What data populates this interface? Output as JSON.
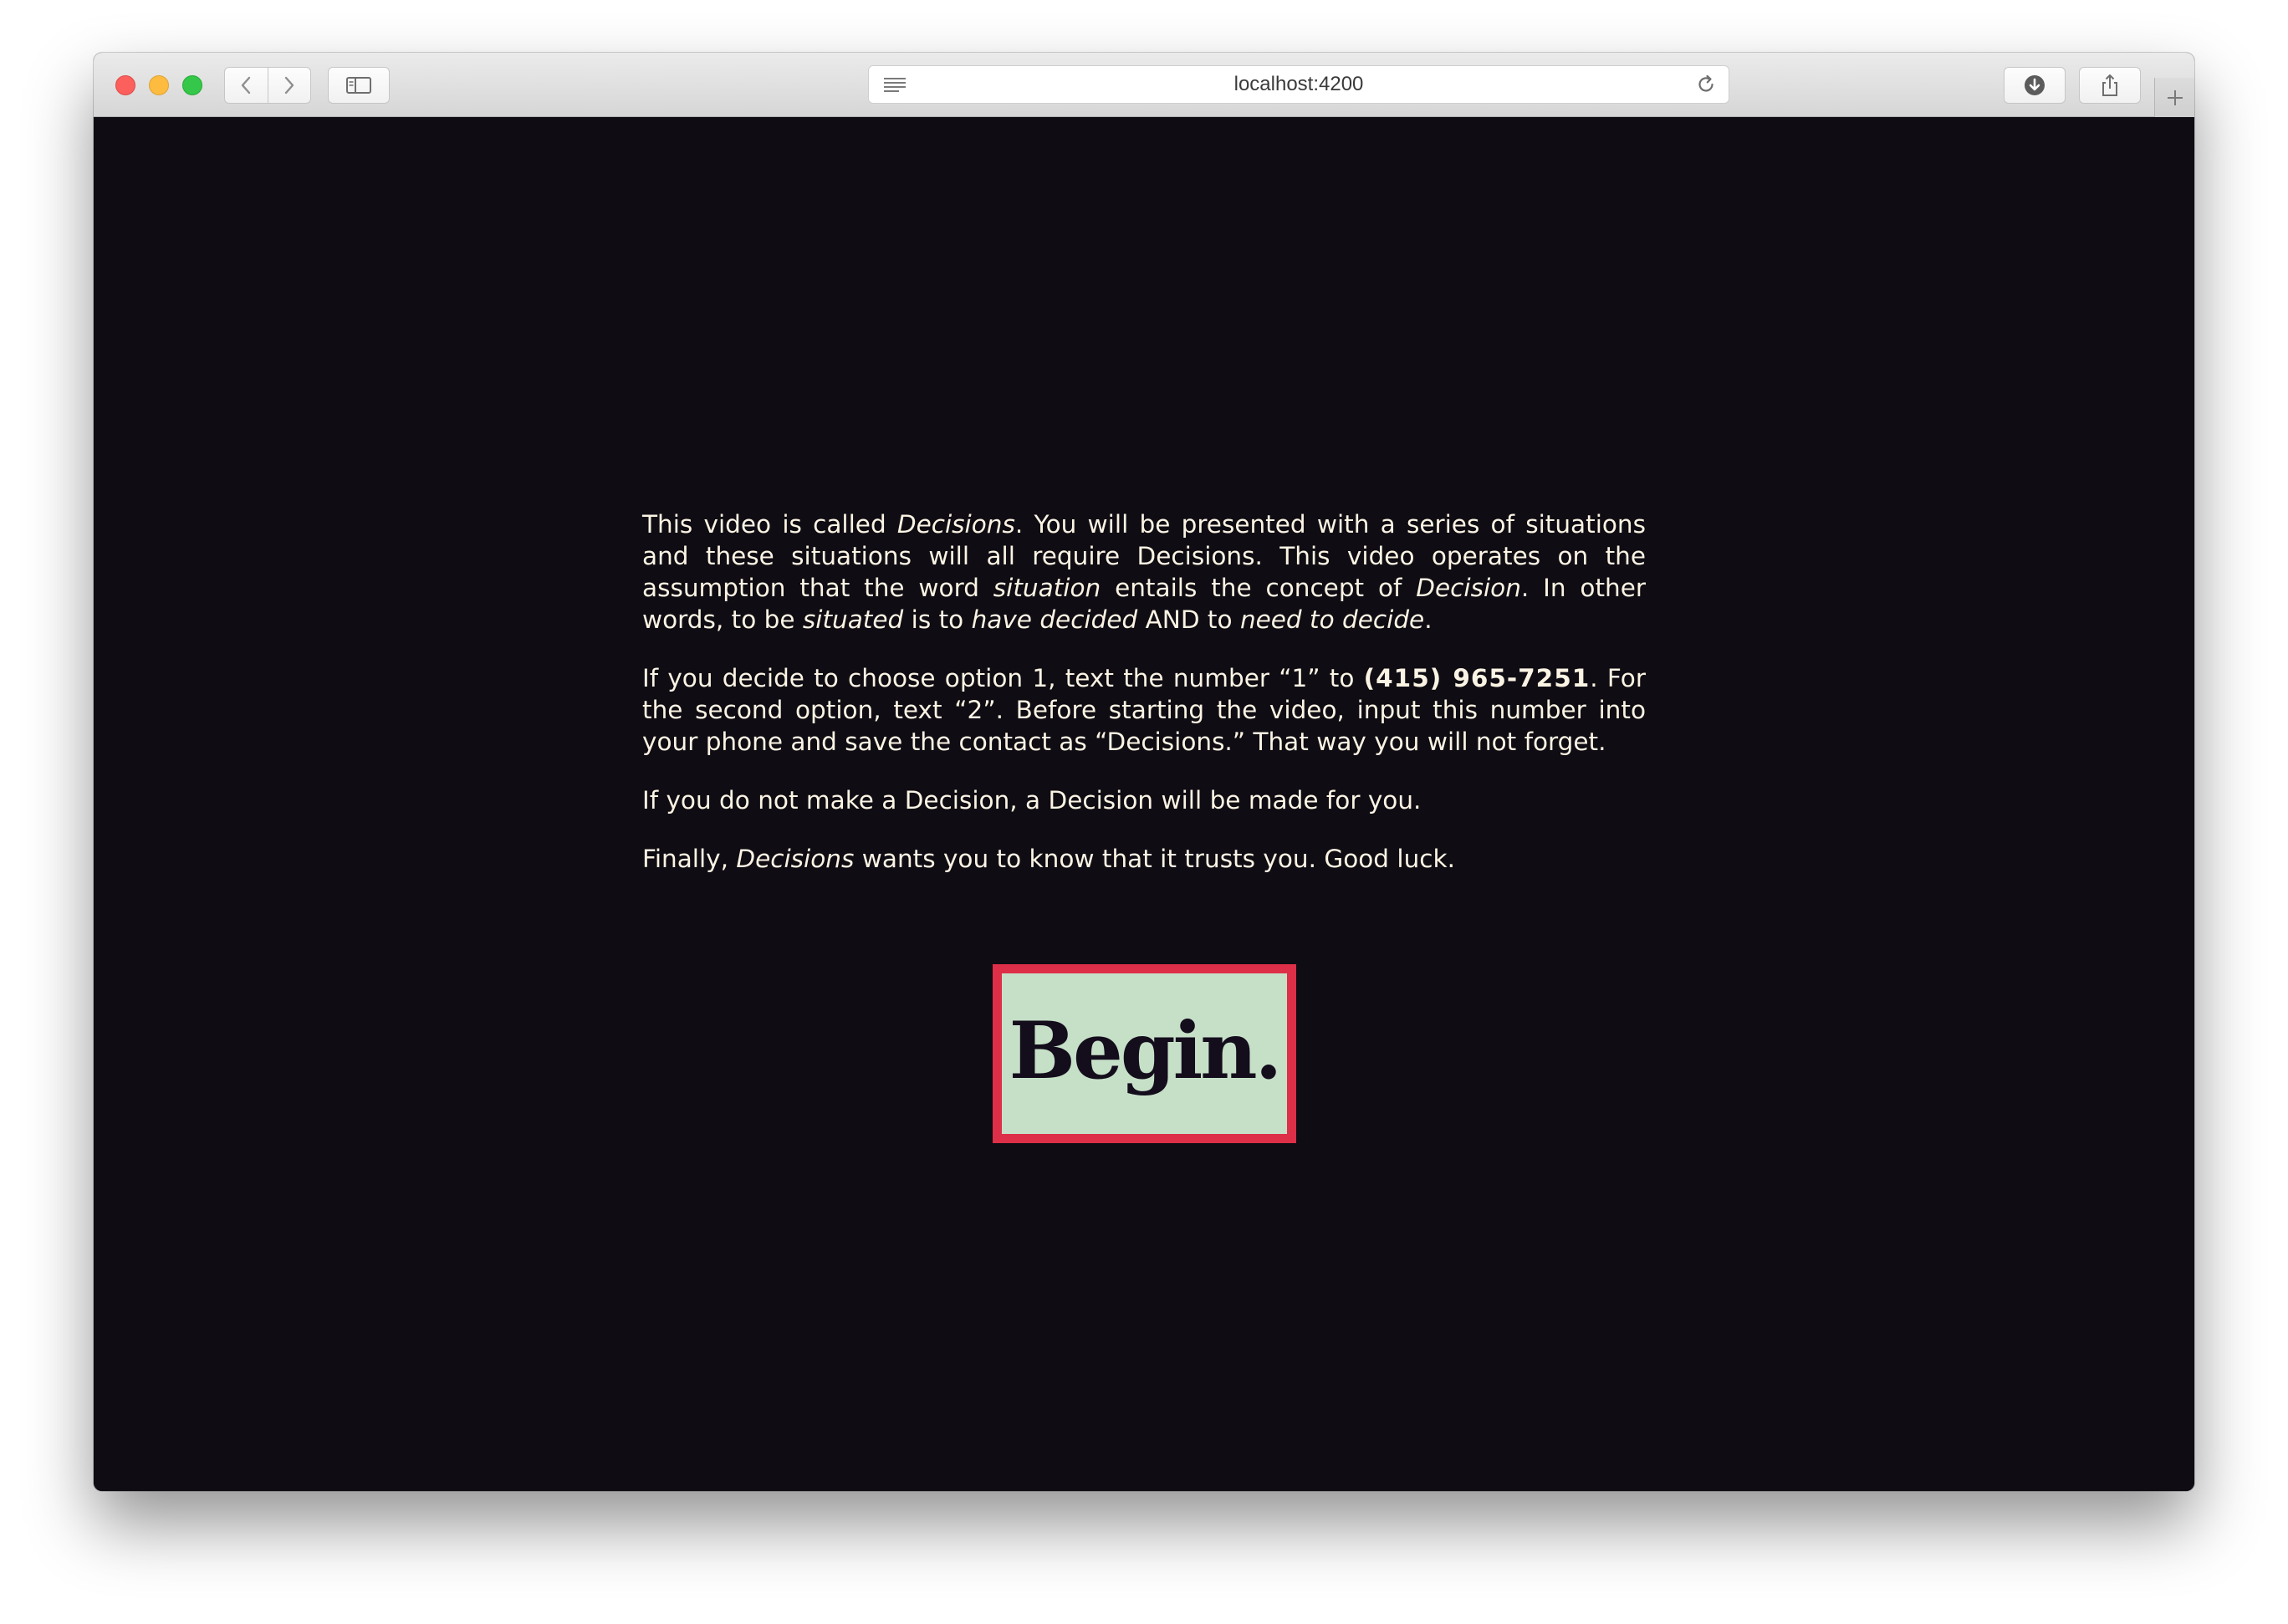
{
  "browser": {
    "url": "localhost:4200",
    "icons": {
      "close": "close-window-icon",
      "minimize": "minimize-window-icon",
      "maximize": "maximize-window-icon",
      "back": "chevron-left-icon",
      "forward": "chevron-right-icon",
      "sidebar": "sidebar-icon",
      "reader": "reader-lines-icon",
      "reload": "reload-icon",
      "download": "download-icon",
      "share": "share-icon",
      "new_tab": "plus-icon"
    }
  },
  "intro": {
    "p1": {
      "t1": "This video is called ",
      "e1": "Decisions",
      "t2": ". You will be presented with a series of situations and these situations will all require Decisions. This video operates on the assumption that the word ",
      "e2": "situation",
      "t3": " entails the concept of ",
      "e3": "Decision",
      "t4": ". In other words, to be ",
      "e4": "situated",
      "t5": " is to ",
      "e5": "have decided",
      "t6": " AND to ",
      "e6": "need to decide",
      "t7": "."
    },
    "p2": {
      "t1": "If you decide to choose option 1, text the number “1” to ",
      "phone": "(415) 965-7251",
      "t2": ". For the second option, text “2”. Before starting the video, input this number into your phone and save the contact as “Decisions.” That way you will not forget."
    },
    "p3": {
      "t1": "If you do not make a Decision, a Decision will be made for you."
    },
    "p4": {
      "t1": "Finally, ",
      "e1": "Decisions",
      "t2": " wants you to know that it trusts you. Good luck."
    }
  },
  "begin": {
    "label": "Begin."
  },
  "colors": {
    "background": "#0f0c13",
    "text": "#fbf4e4",
    "button_fill": "#c6e0c8",
    "button_border": "#dd2f47",
    "button_text": "#140d1c"
  }
}
